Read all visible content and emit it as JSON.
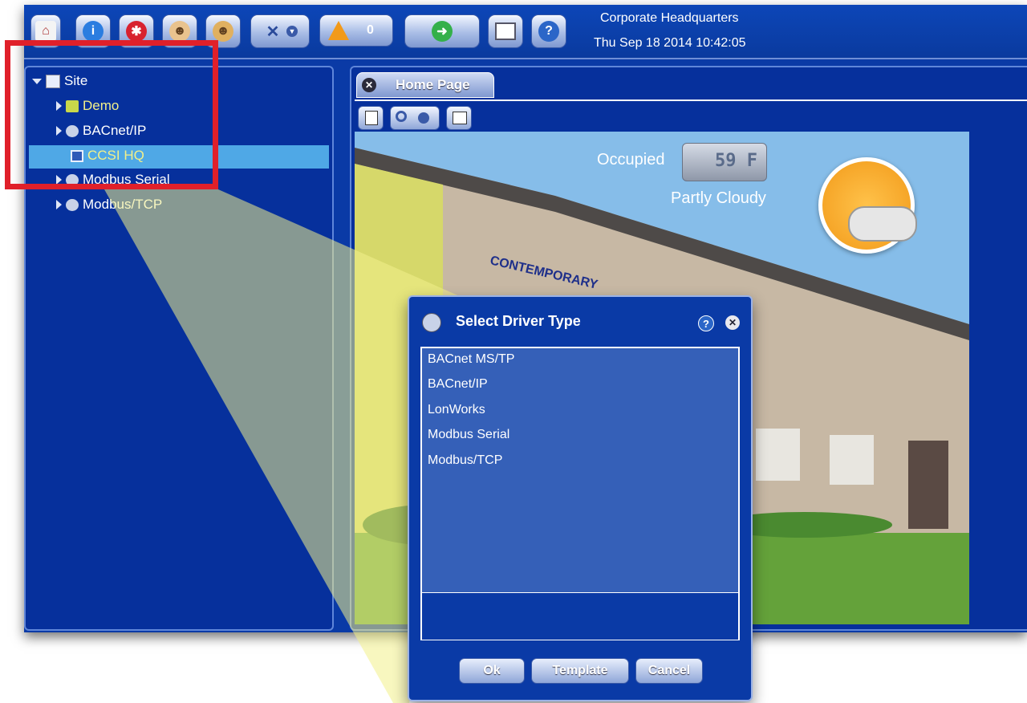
{
  "header": {
    "title": "Corporate Headquarters",
    "datetime": "Thu Sep 18 2014 10:42:05",
    "alarm_count": "0"
  },
  "toolbar": {
    "buttons": [
      "home-icon",
      "info-icon",
      "alarm-icon",
      "user-icon",
      "users-icon",
      "tools-icon",
      "warning-icon",
      "run-icon",
      "window-icon",
      "help-icon"
    ]
  },
  "tree": {
    "items": [
      {
        "label": "Site",
        "icon": "site-icon"
      },
      {
        "label": "Demo",
        "icon": "folder-icon"
      },
      {
        "label": "BACnet/IP",
        "icon": "network-globe-icon"
      },
      {
        "label": "CCSI HQ",
        "icon": "monitor-icon"
      },
      {
        "label": "Modbus Serial",
        "icon": "network-globe-icon"
      },
      {
        "label": "Modbus/TCP",
        "icon": "network-globe-icon"
      }
    ]
  },
  "tab": {
    "label": "Home Page"
  },
  "home": {
    "occupancy": "Occupied",
    "temperature": "59 F",
    "weather": "Partly Cloudy",
    "sign_text": "CONTEMPORARY"
  },
  "dialog": {
    "title": "Select Driver Type",
    "options": [
      "BACnet MS/TP",
      "BACnet/IP",
      "LonWorks",
      "Modbus Serial",
      "Modbus/TCP"
    ],
    "ok_label": "Ok",
    "template_label": "Template",
    "cancel_label": "Cancel"
  },
  "colors": {
    "app_blue": "#0a3aa6",
    "selection": "#4fa8e6",
    "highlight_yellow": "#f2f08a",
    "callout_red": "#e0202a"
  }
}
